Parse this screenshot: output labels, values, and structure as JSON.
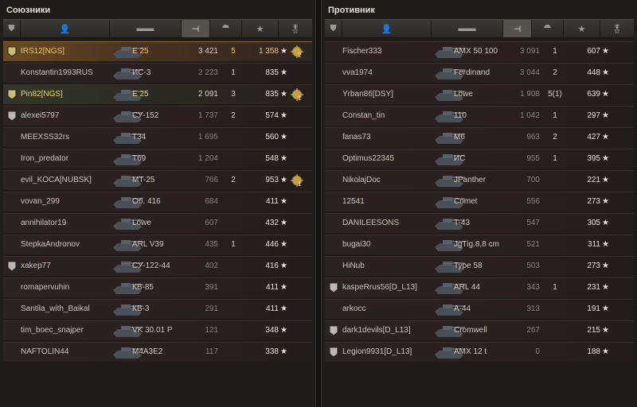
{
  "allies": {
    "title": "Союзники",
    "players": [
      {
        "name": "IRS12[NGS]",
        "tank": "E 25",
        "dmg": "3 421",
        "frags": "5",
        "xp": "1 358",
        "medal": "2",
        "badge": "platoon",
        "me": true
      },
      {
        "name": "Konstantin1993RUS",
        "tank": "ИС-3",
        "dmg": "2 223",
        "frags": "1",
        "xp": "835",
        "medal": "",
        "badge": ""
      },
      {
        "name": "Pin82[NGS]",
        "tank": "E 25",
        "dmg": "2 091",
        "frags": "3",
        "xp": "835",
        "medal": "1",
        "badge": "platoon",
        "pl": true
      },
      {
        "name": "alexei5797",
        "tank": "СУ-152",
        "dmg": "1 737",
        "frags": "2",
        "xp": "574",
        "medal": "",
        "badge": "silver"
      },
      {
        "name": "MEEXSS32rs",
        "tank": "T34",
        "dmg": "1 695",
        "frags": "",
        "xp": "560",
        "medal": "",
        "badge": ""
      },
      {
        "name": "Iron_predator",
        "tank": "T69",
        "dmg": "1 204",
        "frags": "",
        "xp": "548",
        "medal": "",
        "badge": ""
      },
      {
        "name": "evil_KOCA[NUBSK]",
        "tank": "MT-25",
        "dmg": "766",
        "frags": "2",
        "xp": "953",
        "medal": "1",
        "badge": ""
      },
      {
        "name": "vovan_299",
        "tank": "Об. 416",
        "dmg": "684",
        "frags": "",
        "xp": "411",
        "medal": "",
        "badge": ""
      },
      {
        "name": "annihilator19",
        "tank": "Löwe",
        "dmg": "607",
        "frags": "",
        "xp": "432",
        "medal": "",
        "badge": ""
      },
      {
        "name": "StepkaAndronov",
        "tank": "ARL V39",
        "dmg": "435",
        "frags": "1",
        "xp": "446",
        "medal": "",
        "badge": ""
      },
      {
        "name": "xakep77",
        "tank": "СУ-122-44",
        "dmg": "402",
        "frags": "",
        "xp": "416",
        "medal": "",
        "badge": "silver"
      },
      {
        "name": "romapervuhin",
        "tank": "КВ-85",
        "dmg": "391",
        "frags": "",
        "xp": "411",
        "medal": "",
        "badge": ""
      },
      {
        "name": "Santila_with_Baikal",
        "tank": "КВ-3",
        "dmg": "291",
        "frags": "",
        "xp": "411",
        "medal": "",
        "badge": ""
      },
      {
        "name": "tim_boec_snajper",
        "tank": "VK 30.01 P",
        "dmg": "121",
        "frags": "",
        "xp": "348",
        "medal": "",
        "badge": ""
      },
      {
        "name": "NAFTOLIN44",
        "tank": "M4A3E2",
        "dmg": "117",
        "frags": "",
        "xp": "338",
        "medal": "",
        "badge": ""
      }
    ]
  },
  "enemies": {
    "title": "Противник",
    "players": [
      {
        "name": "Fischer333",
        "tank": "AMX 50 100",
        "dmg": "3 091",
        "frags": "1",
        "xp": "607",
        "badge": ""
      },
      {
        "name": "vva1974",
        "tank": "Ferdinand",
        "dmg": "3 044",
        "frags": "2",
        "xp": "448",
        "badge": ""
      },
      {
        "name": "Yrban86[DSY]",
        "tank": "Löwe",
        "dmg": "1 908",
        "frags": "5(1)",
        "xp": "639",
        "badge": ""
      },
      {
        "name": "Constan_tin",
        "tank": "110",
        "dmg": "1 042",
        "frags": "1",
        "xp": "297",
        "badge": ""
      },
      {
        "name": "fanas73",
        "tank": "M6",
        "dmg": "963",
        "frags": "2",
        "xp": "427",
        "badge": ""
      },
      {
        "name": "Optimus22345",
        "tank": "ИС",
        "dmg": "955",
        "frags": "1",
        "xp": "395",
        "badge": ""
      },
      {
        "name": "NikolajDoc",
        "tank": "JPanther",
        "dmg": "700",
        "frags": "",
        "xp": "221",
        "badge": ""
      },
      {
        "name": "12541",
        "tank": "Comet",
        "dmg": "556",
        "frags": "",
        "xp": "273",
        "badge": ""
      },
      {
        "name": "DANILEESONS",
        "tank": "T-43",
        "dmg": "547",
        "frags": "",
        "xp": "305",
        "badge": ""
      },
      {
        "name": "bugai30",
        "tank": "JgTig.8,8 cm",
        "dmg": "521",
        "frags": "",
        "xp": "311",
        "badge": ""
      },
      {
        "name": "HiNub",
        "tank": "Type 58",
        "dmg": "503",
        "frags": "",
        "xp": "273",
        "badge": ""
      },
      {
        "name": "kaspeRrus56[D_L13]",
        "tank": "ARL 44",
        "dmg": "343",
        "frags": "1",
        "xp": "231",
        "badge": "silver"
      },
      {
        "name": "arkocc",
        "tank": "A-44",
        "dmg": "313",
        "frags": "",
        "xp": "191",
        "badge": ""
      },
      {
        "name": "dark1devils[D_L13]",
        "tank": "Cromwell",
        "dmg": "267",
        "frags": "",
        "xp": "215",
        "badge": "silver"
      },
      {
        "name": "Legion9931[D_L13]",
        "tank": "AMX 12 t",
        "dmg": "0",
        "frags": "",
        "xp": "188",
        "badge": "silver"
      }
    ]
  },
  "star_glyph": "★"
}
